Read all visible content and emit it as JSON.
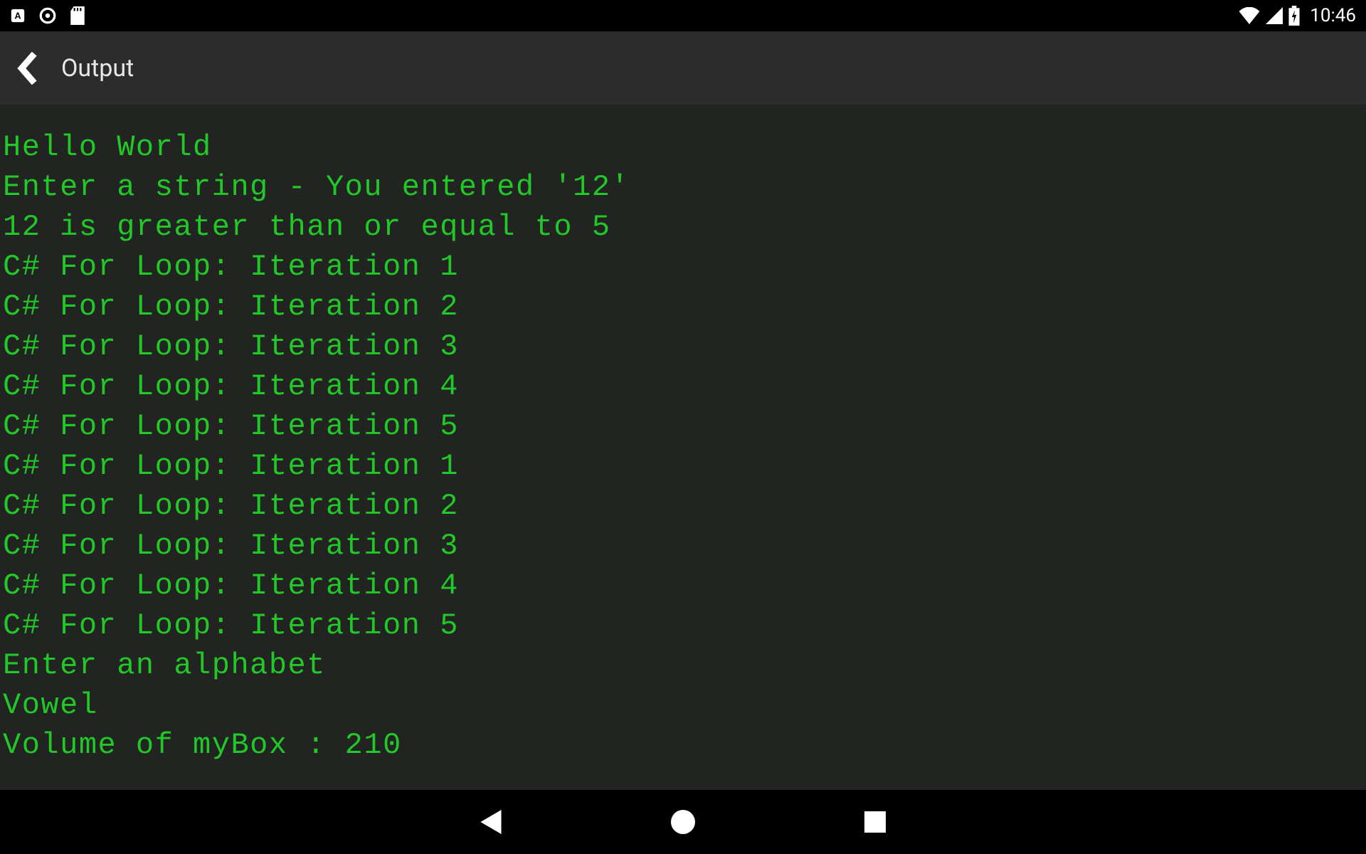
{
  "status_bar": {
    "clock": "10:46"
  },
  "app_bar": {
    "title": "Output"
  },
  "output_lines": [
    "Hello World",
    "Enter a string - You entered '12'",
    "12 is greater than or equal to 5",
    "C# For Loop: Iteration 1",
    "C# For Loop: Iteration 2",
    "C# For Loop: Iteration 3",
    "C# For Loop: Iteration 4",
    "C# For Loop: Iteration 5",
    "C# For Loop: Iteration 1",
    "C# For Loop: Iteration 2",
    "C# For Loop: Iteration 3",
    "C# For Loop: Iteration 4",
    "C# For Loop: Iteration 5",
    "Enter an alphabet",
    "Vowel",
    "Volume of myBox : 210"
  ]
}
